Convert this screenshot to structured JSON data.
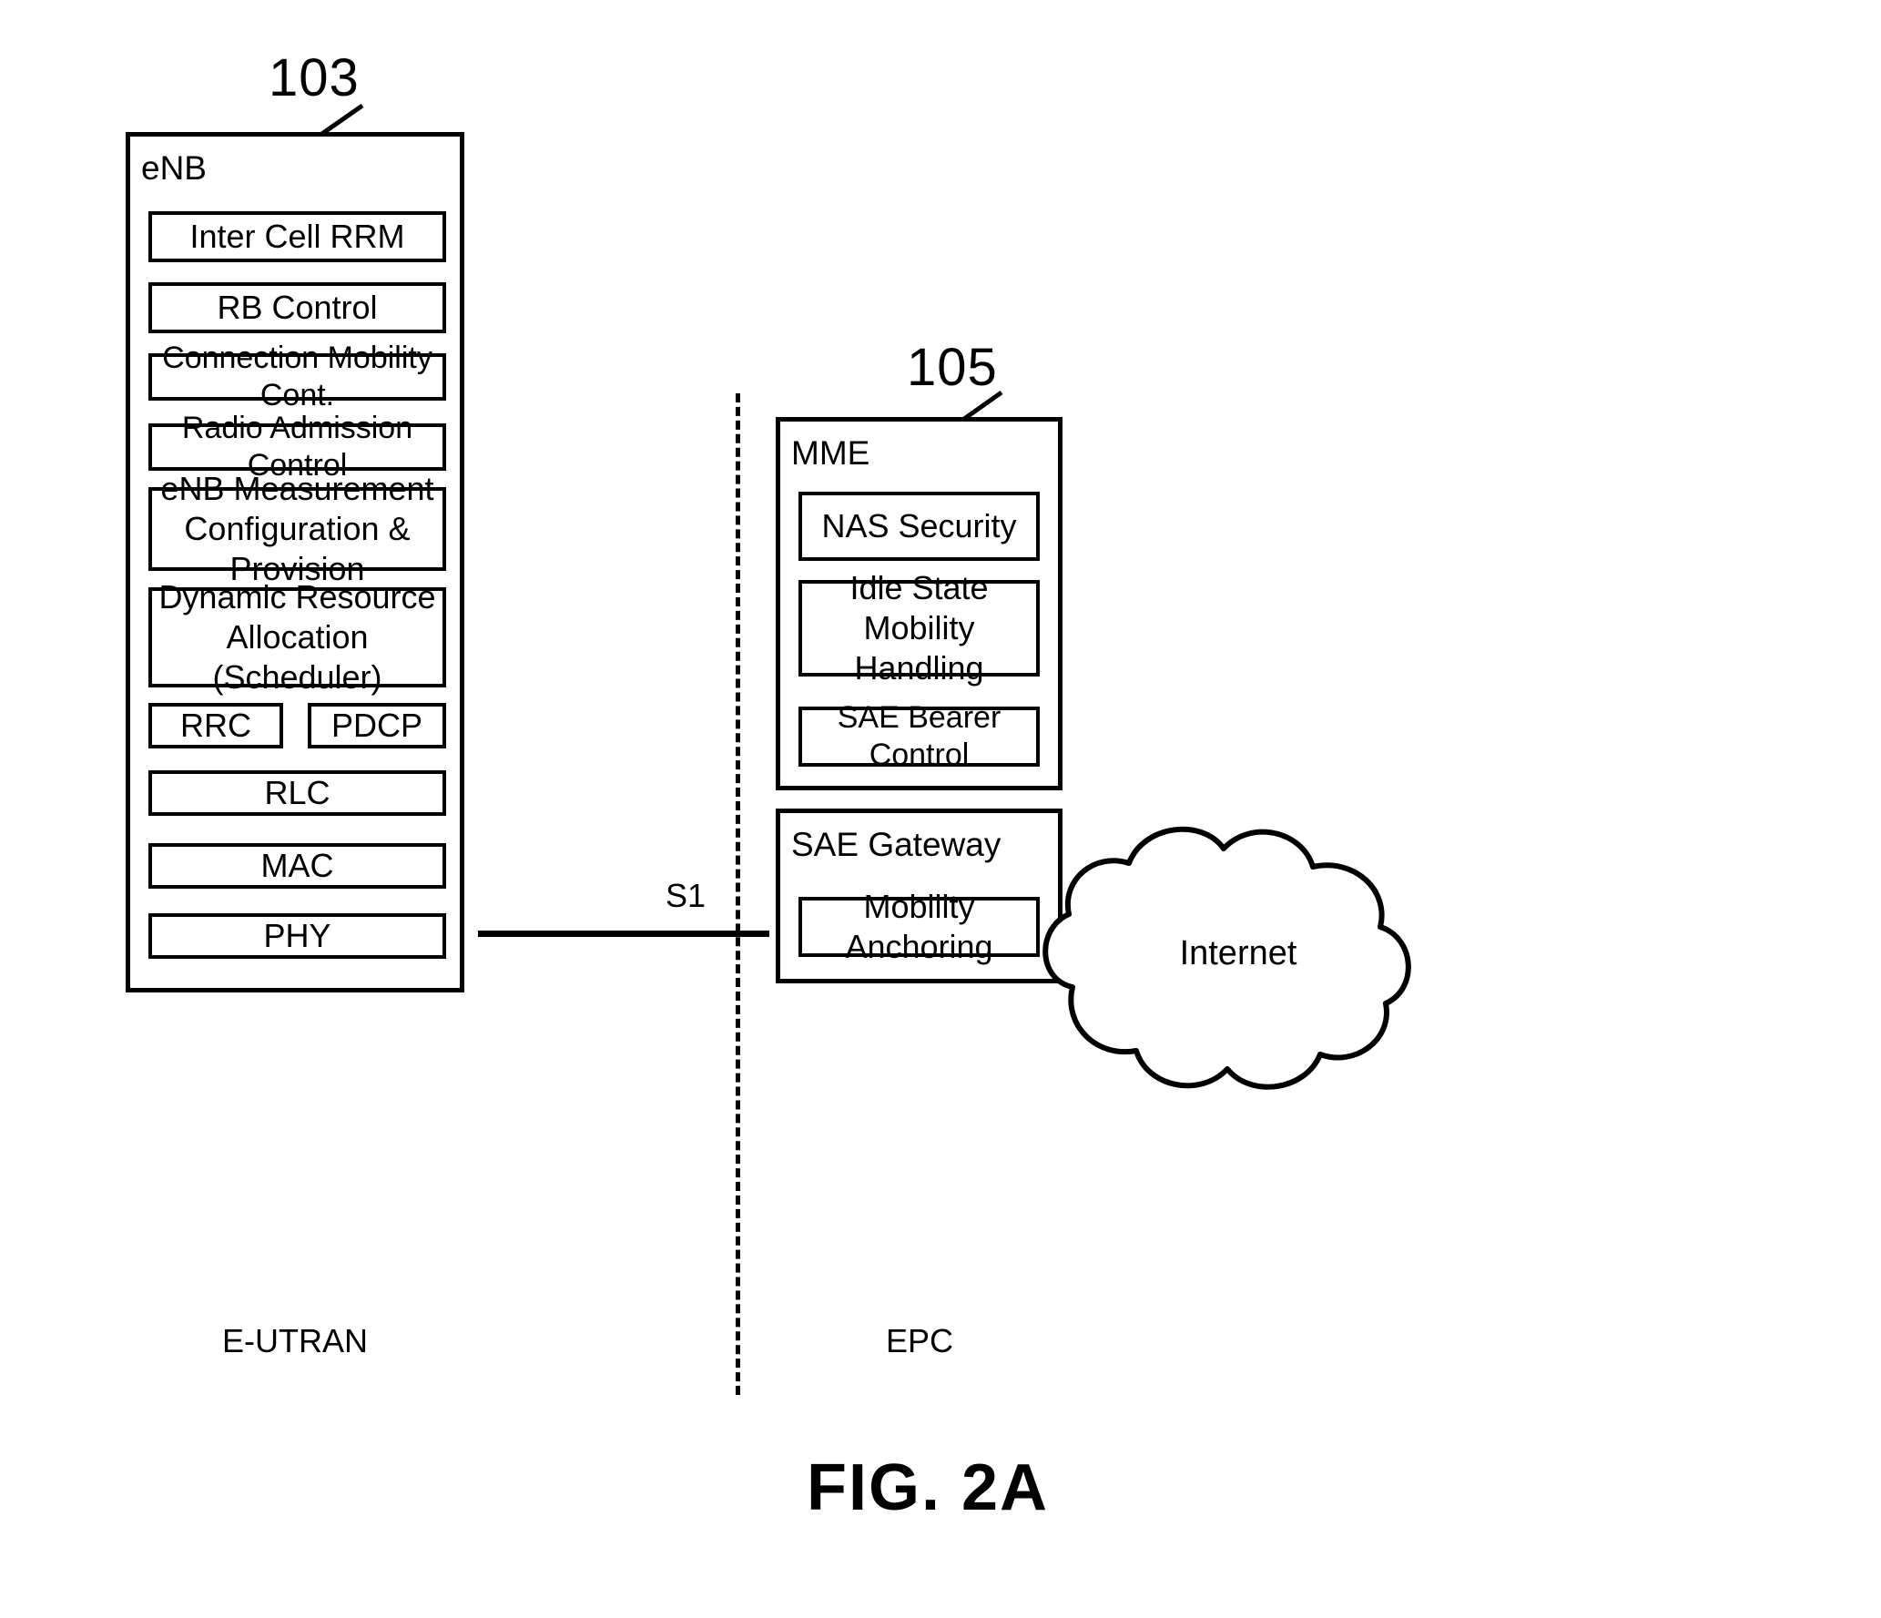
{
  "figure": {
    "caption": "FIG. 2A"
  },
  "callouts": {
    "enb_ref": "103",
    "mme_ref": "105"
  },
  "enb": {
    "title": "eNB",
    "zone_label": "E-UTRAN",
    "functions": [
      {
        "label": "Inter Cell RRM"
      },
      {
        "label": "RB  Control"
      },
      {
        "label": "Connection Mobility Cont."
      },
      {
        "label": "Radio Admission Control"
      },
      {
        "label": "eNB Measurement\nConfiguration & Provision"
      },
      {
        "label": "Dynamic Resource\nAllocation (Scheduler)"
      },
      {
        "label": "RRC"
      },
      {
        "label": "PDCP"
      },
      {
        "label": "RLC"
      },
      {
        "label": "MAC"
      },
      {
        "label": "PHY"
      }
    ]
  },
  "epc": {
    "zone_label": "EPC",
    "mme": {
      "title": "MME",
      "functions": [
        {
          "label": "NAS  Security"
        },
        {
          "label": "Idle State Mobility\nHandling"
        },
        {
          "label": "SAE Bearer Control"
        }
      ]
    },
    "sae_gateway": {
      "title": "SAE Gateway",
      "functions": [
        {
          "label": "Mobility Anchoring"
        }
      ]
    }
  },
  "internet": {
    "label": "Internet"
  },
  "interface": {
    "s1_label": "S1"
  },
  "colors": {
    "stroke": "#000000",
    "background": "#ffffff"
  }
}
